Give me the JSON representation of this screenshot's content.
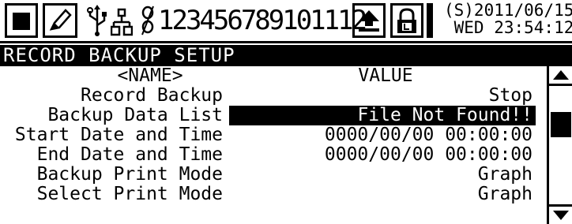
{
  "status": {
    "stop_icon": "stop-square-icon",
    "pen_icon": "pen-icon",
    "usb_icon": "usb-icon",
    "network_icon": "network-icon",
    "link_icon": "link-icon",
    "channels": "123456789101112",
    "upload_icon": "upload-icon",
    "lock_icon": "lock-icon",
    "datetime_line1": "(S)2011/06/15",
    "datetime_line2": " WED 23:54:12"
  },
  "title": "RECORD BACKUP SETUP",
  "table": {
    "header_name": "<NAME>",
    "header_value": "VALUE",
    "rows": [
      {
        "name": "Record Backup",
        "value": "Stop"
      },
      {
        "name": "Backup Data List",
        "value": "File Not Found!!"
      },
      {
        "name": "Start Date and Time",
        "value": "0000/00/00 00:00:00"
      },
      {
        "name": "End Date and Time",
        "value": "0000/00/00 00:00:00"
      },
      {
        "name": "Backup Print Mode",
        "value": "Graph"
      },
      {
        "name": "Select Print Mode",
        "value": "Graph"
      }
    ]
  }
}
